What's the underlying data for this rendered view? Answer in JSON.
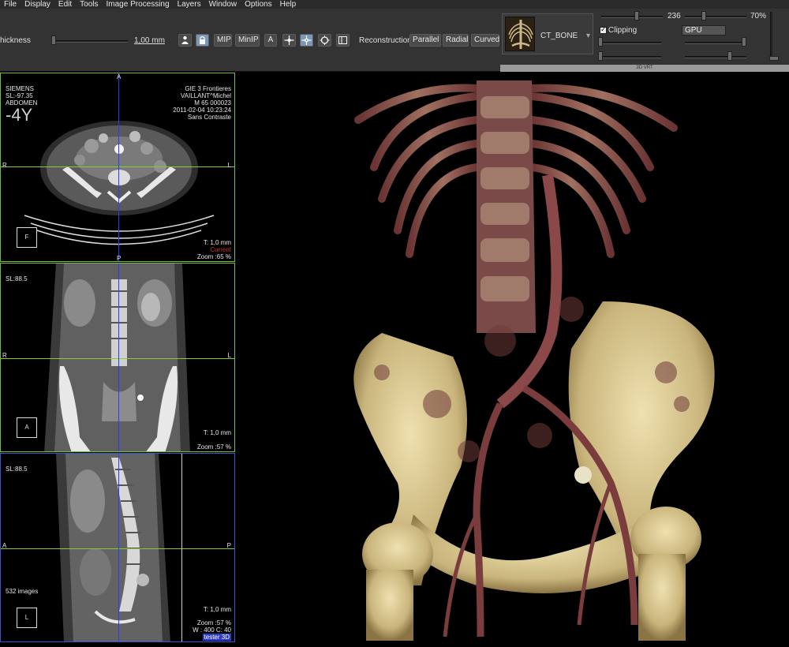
{
  "menu": [
    "File",
    "Display",
    "Edit",
    "Tools",
    "Image Processing",
    "Layers",
    "Window",
    "Options",
    "Help"
  ],
  "toolbar": {
    "thickness_label": "hickness",
    "thickness_value": "1,00 mm",
    "btn_mip": "MIP",
    "btn_minip": "MinIP",
    "btn_a": "A",
    "reconstruction_label": "Reconstruction",
    "btn_parallel": "Parallel",
    "btn_radial": "Radial",
    "btn_curved": "Curved",
    "preset_name": "CT_BONE",
    "preset_arrow": "▾",
    "value_236": "236",
    "value_70": "70%",
    "clipping_label": "Clipping",
    "clipping_check": "✓",
    "gpu_value": "GPU",
    "strip_label": "3D VRT",
    "icons": [
      "person-icon",
      "lock-icon",
      "crosshair-icon",
      "move-icon",
      "target-icon",
      "layout-icon"
    ]
  },
  "axial": {
    "top_marker": "A",
    "left_lines": [
      "SIEMENS",
      "SL:-97.35",
      "ABDOMEN"
    ],
    "age": "-4Y",
    "right_lines": [
      "GIE 3 Frontieres",
      "VAILLANT^Michel",
      "M 65 000023",
      "2011-02-04 10:23:24",
      "Sans Contraste"
    ],
    "left_marker": "R",
    "right_marker": "L",
    "bottom_marker": "P",
    "orientation": "F",
    "thickness": "T: 1,0 mm",
    "current": "Current",
    "zoom": "Zoom :65 %"
  },
  "coronal": {
    "sl": "SL:88.5",
    "left_marker": "R",
    "right_marker": "L",
    "orientation": "A",
    "thickness": "T: 1,0 mm",
    "zoom": "Zoom :57 %"
  },
  "sagittal": {
    "sl": "SL:88.5",
    "left_marker": "A",
    "right_marker": "P",
    "images": "532 images",
    "orientation": "L",
    "thickness": "T: 1,0 mm",
    "zoom": "Zoom :57 %",
    "wl": "W : 400 C: 40",
    "user": "tester 3D"
  },
  "colors": {
    "crosshair_green": "#7fd13b",
    "crosshair_blue": "#2a3cff",
    "frame_green": "#6fbf3a",
    "frame_blue": "#3a55c8",
    "bone": "#d9c98e",
    "vessel": "#7a3c3c"
  }
}
